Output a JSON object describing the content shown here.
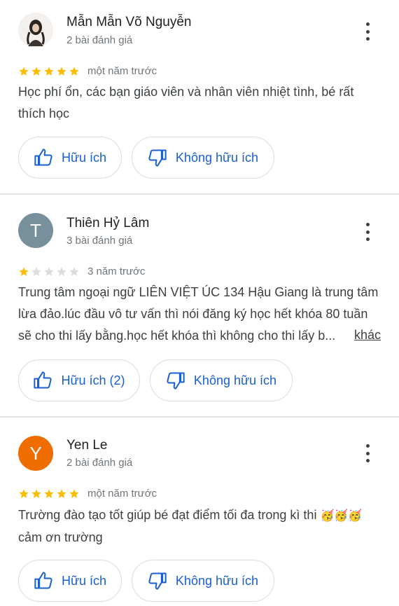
{
  "reviews": [
    {
      "name": "Mẫn Mẫn Võ Nguyễn",
      "review_count": "2 bài đánh giá",
      "rating": 5,
      "date": "một năm trước",
      "text_lines": [
        "Học phí ổn, các bạn giáo viên và nhân viên nhiệt tình, bé rất",
        "thích học"
      ],
      "helpful_label": "Hữu ích",
      "not_helpful_label": "Không hữu ích"
    },
    {
      "name": "Thiên Hỷ Lâm",
      "avatar_letter": "T",
      "avatar_color": "#78909c",
      "review_count": "3 bài đánh giá",
      "rating": 1,
      "date": "3 năm trước",
      "text_lines": [
        "Trung tâm ngoại ngữ LIÊN VIỆT ÚC 134 Hậu Giang là trung tâm",
        "lừa đảo.lúc đầu vô tư vấn thì nói đăng ký học hết khóa 80 tuần",
        "sẽ cho thi lấy bằng.học hết khóa thì không cho thi lấy b..."
      ],
      "more_label": "khác",
      "helpful_label": "Hữu ích (2)",
      "not_helpful_label": "Không hữu ích"
    },
    {
      "name": "Yen Le",
      "avatar_letter": "Y",
      "avatar_color": "#ef6c00",
      "review_count": "2 bài đánh giá",
      "rating": 5,
      "date": "một năm trước",
      "text_lines": [
        "Trường đào tạo tốt giúp bé đạt điểm tối đa trong kì thi",
        "cảm ơn trường"
      ],
      "emoji": "🥳🥳🥳",
      "helpful_label": "Hữu ích",
      "not_helpful_label": "Không hữu ích"
    }
  ],
  "colors": {
    "star_filled": "#fbbc04",
    "star_empty": "#dadce0",
    "button_text": "#1a5fd0"
  }
}
